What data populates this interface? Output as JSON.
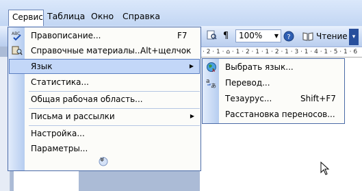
{
  "menubar": {
    "items": [
      {
        "label": "Сервис",
        "key": "С"
      },
      {
        "label": "Таблица",
        "key": "Т"
      },
      {
        "label": "Окно",
        "key": "О"
      },
      {
        "label": "Справка",
        "key": "С"
      }
    ]
  },
  "toolbar": {
    "zoom_value": "100%",
    "pilcrow": "¶",
    "reading_label": "Чтение"
  },
  "ruler": {
    "text": "· 2 · 1 · ⌂ · 1 · 2 · 1 · 1 · 2 · 1 · 3 · 1 · 4 · 1 · 5 · 1 · 6"
  },
  "main_menu": {
    "items": [
      {
        "label": "Правописание...",
        "shortcut": "F7",
        "icon": "spelling-abc-icon"
      },
      {
        "label": "Справочные материалы...",
        "shortcut": "Alt+щелчок",
        "icon": "research-book-icon"
      },
      {
        "label": "Язык",
        "has_submenu": true,
        "highlighted": true
      },
      {
        "label": "Статистика..."
      },
      {
        "label": "Общая рабочая область..."
      },
      {
        "label": "Письма и рассылки",
        "has_submenu": true
      },
      {
        "label": "Настройка..."
      },
      {
        "label": "Параметры..."
      }
    ],
    "expand_label": "»"
  },
  "sub_menu": {
    "items": [
      {
        "label": "Выбрать язык...",
        "icon": "globe-icon"
      },
      {
        "label": "Перевод...",
        "icon": "translate-icon"
      },
      {
        "label": "Тезаурус...",
        "shortcut": "Shift+F7"
      },
      {
        "label": "Расстановка переносов..."
      }
    ]
  },
  "colors": {
    "menu_highlight": "#c3d7f8",
    "menu_border": "#4a6aa7",
    "toolbar": "#c9daf4"
  }
}
